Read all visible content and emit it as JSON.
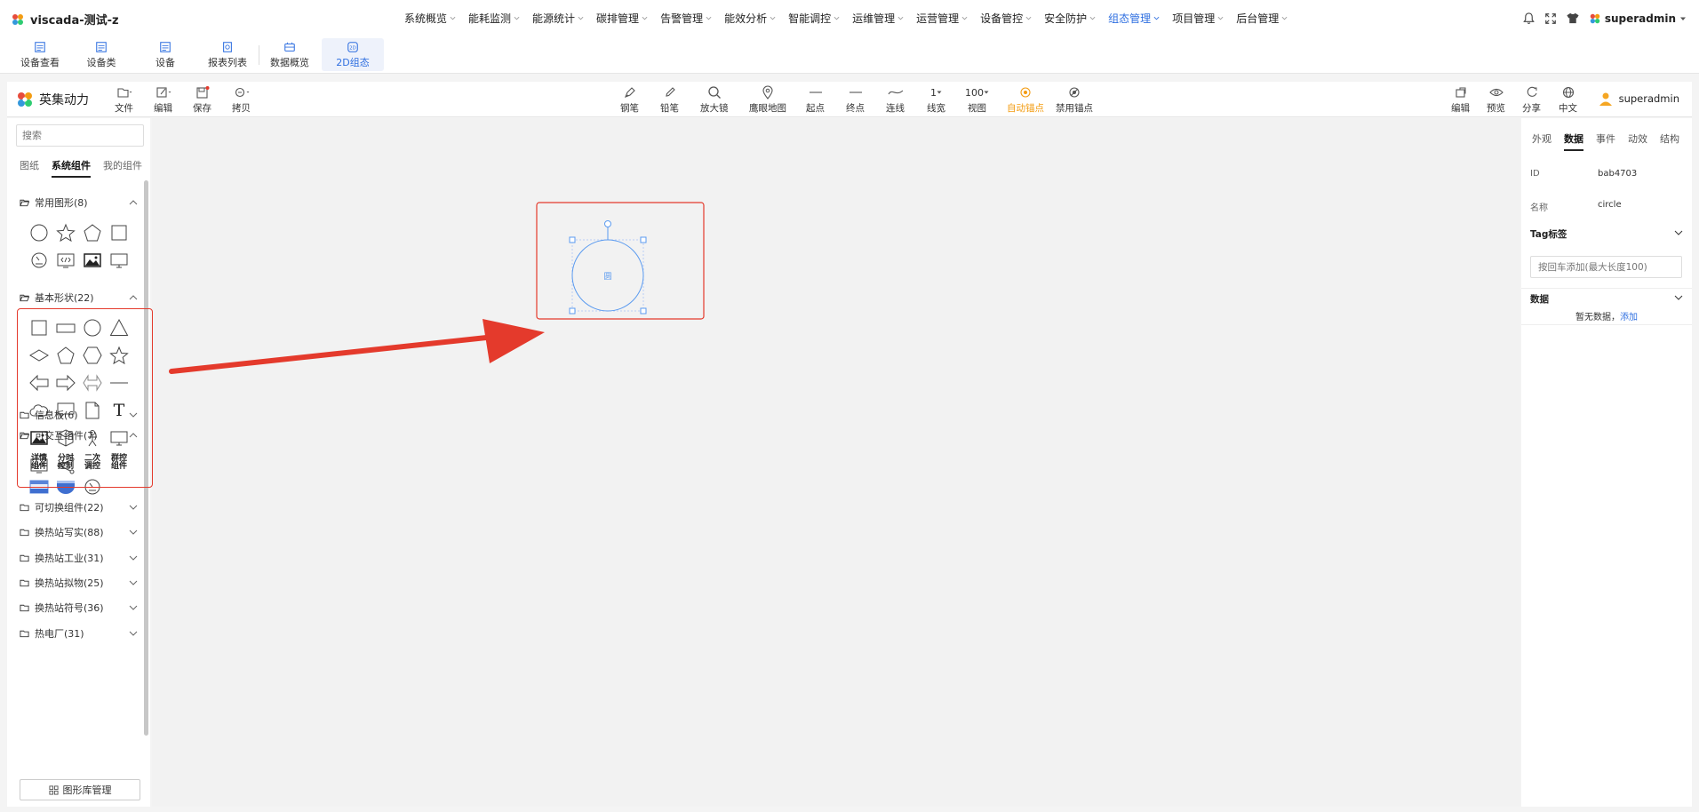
{
  "app": {
    "title": "viscada-测试-z",
    "user": "superadmin"
  },
  "nav": [
    {
      "label": "系统概览",
      "active": false
    },
    {
      "label": "能耗监测",
      "active": false
    },
    {
      "label": "能源统计",
      "active": false
    },
    {
      "label": "碳排管理",
      "active": false
    },
    {
      "label": "告警管理",
      "active": false
    },
    {
      "label": "能效分析",
      "active": false
    },
    {
      "label": "智能调控",
      "active": false
    },
    {
      "label": "运维管理",
      "active": false
    },
    {
      "label": "运营管理",
      "active": false
    },
    {
      "label": "设备管控",
      "active": false
    },
    {
      "label": "安全防护",
      "active": false
    },
    {
      "label": "组态管理",
      "active": true
    },
    {
      "label": "项目管理",
      "active": false
    },
    {
      "label": "后台管理",
      "active": false
    }
  ],
  "modules": [
    {
      "label": "设备查看"
    },
    {
      "label": "设备类"
    },
    {
      "label": "设备"
    },
    {
      "label": "报表列表"
    },
    {
      "label": "数据概览"
    },
    {
      "label": "2D组态"
    }
  ],
  "editor": {
    "brand": "英集动力",
    "user": "superadmin",
    "left_tools": [
      "文件",
      "编辑",
      "保存",
      "拷贝"
    ],
    "center_tools": [
      "钢笔",
      "铅笔",
      "放大镜",
      "鹰眼地图",
      "起点",
      "终点",
      "连线",
      "线宽",
      "视图",
      "自动锚点",
      "禁用锚点"
    ],
    "line_width_value": "1",
    "zoom_value": "100",
    "right_tools": [
      "编辑",
      "预览",
      "分享",
      "中文"
    ]
  },
  "left_panel": {
    "search_placeholder": "搜索",
    "tabs": [
      "图纸",
      "系统组件",
      "我的组件"
    ],
    "groups": {
      "common": "常用图形(8)",
      "basic": "基本形状(22)",
      "info": "信息板(6)",
      "interactive": "可交互组件(7)",
      "switchable": "可切换组件(22)",
      "realistic": "换热站写实(88)",
      "industrial": "换热站工业(31)",
      "mimic": "换热站拟物(25)",
      "symbol": "换热站符号(36)",
      "plant": "热电厂(31)"
    },
    "interactive_items": [
      "详情组件",
      "分时控制",
      "二次调控",
      "群控组件"
    ],
    "text_shape_glyph": "T",
    "library_button": "图形库管理"
  },
  "canvas": {
    "selected_label": "圆"
  },
  "right_panel": {
    "tabs": [
      "外观",
      "数据",
      "事件",
      "动效",
      "结构"
    ],
    "id_label": "ID",
    "id_value": "bab4703",
    "name_label": "名称",
    "name_value": "circle",
    "tag_section": "Tag标签",
    "tag_placeholder": "按回车添加(最大长度100)",
    "data_section": "数据",
    "empty_text": "暂无数据，",
    "add_link": "添加"
  },
  "colors": {
    "accent": "#2f6fe0",
    "annotation_red": "#e43a2c",
    "orange": "#f39c12"
  }
}
